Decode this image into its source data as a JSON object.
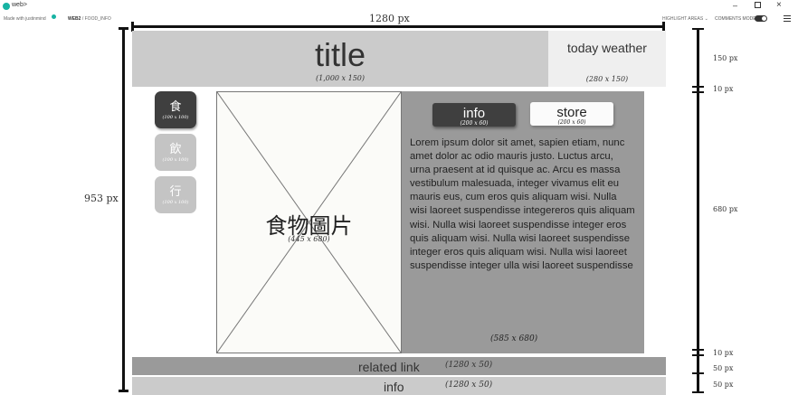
{
  "app": {
    "name": "web>",
    "user": "Made with justinmind",
    "page": "WEB2",
    "subpage": " / FOOD_INFO",
    "highlight_dropdown": "HIGHLIGHT AREAS ⌄",
    "comments_label": "COMMENTS MODE",
    "win_min": "–",
    "win_close": "×"
  },
  "dimensions": {
    "top_width": "1280 px",
    "left_height": "953 px",
    "right": [
      "150 px",
      "10 px",
      "680 px",
      "10 px",
      "50 px",
      "50 px"
    ]
  },
  "header": {
    "title": "title",
    "title_note": "(1,000 x 150)",
    "weather": "today weather",
    "weather_note": "(280 x 150)"
  },
  "tabs": [
    {
      "label": "食",
      "note": "(100 x 100)",
      "active": true
    },
    {
      "label": "飲",
      "note": "(100 x 100)",
      "active": false
    },
    {
      "label": "行",
      "note": "(100 x 100)",
      "active": false
    }
  ],
  "image": {
    "label": "食物圖片",
    "note": "(445 x 680)"
  },
  "panel": {
    "info_button": "info",
    "info_note": "(200 x 60)",
    "store_button": "store",
    "store_note": "(200 x 60)",
    "text": "Lorem ipsum dolor sit amet, sapien etiam, nunc amet dolor ac odio mauris justo. Luctus arcu, urna praesent at id quisque ac. Arcu es massa vestibulum malesuada, integer vivamus elit eu mauris eus, cum eros quis aliquam wisi. Nulla wisi laoreet suspendisse integereros quis aliquam wisi. Nulla wisi laoreet suspendisse integer eros quis aliquam wisi. Nulla wisi laoreet suspendisse integer eros quis aliquam wisi. Nulla wisi laoreet suspendisse integer ulla wisi laoreet suspendisse",
    "note": "(585 x 680)"
  },
  "footer": {
    "related_label": "related link",
    "related_note": "(1280 x 50)",
    "info_label": "info",
    "info_note": "(1280 x 50)"
  }
}
